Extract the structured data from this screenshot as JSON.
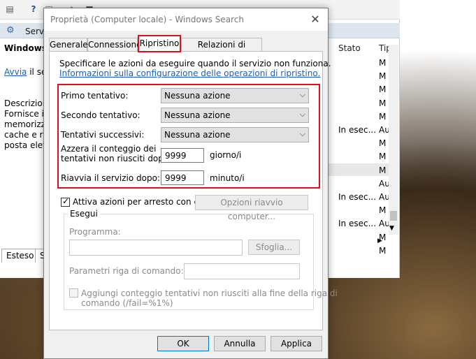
{
  "background": {
    "panel_label": "Servizi",
    "service_title": "Windows S",
    "start_link": "Avvia",
    "start_suffix": " il ser",
    "description_heading": "Descrizione",
    "description_lines": [
      "Fornisce in",
      "memorizza",
      "cache e ris",
      "posta elett"
    ],
    "columns": {
      "status": "Stato",
      "type": "Tip"
    },
    "rows": [
      {
        "status": "",
        "type": "M"
      },
      {
        "status": "",
        "type": "M"
      },
      {
        "status": "",
        "type": "M"
      },
      {
        "status": "",
        "type": "M"
      },
      {
        "status": "",
        "type": "M"
      },
      {
        "status": "In esec...",
        "type": "Au"
      },
      {
        "status": "",
        "type": "M"
      },
      {
        "status": "",
        "type": "M"
      },
      {
        "status": "",
        "type": "M"
      },
      {
        "status": "",
        "type": "Au"
      },
      {
        "status": "In esec...",
        "type": "Au"
      },
      {
        "status": "",
        "type": "M"
      },
      {
        "status": "In esec...",
        "type": "Au"
      },
      {
        "status": "",
        "type": "M"
      },
      {
        "status": "",
        "type": "M"
      }
    ],
    "tabs": [
      "Esteso",
      "S"
    ]
  },
  "dialog": {
    "title": "Proprietà (Computer locale) - Windows Search",
    "tabs": [
      "Generale",
      "Connessione",
      "Ripristino",
      "Relazioni di dipendenza"
    ],
    "active_tab": "Ripristino",
    "intro": "Specificare le azioni da eseguire quando il servizio non funziona.",
    "info_link": "Informazioni sulla configurazione delle operazioni di ripristino.",
    "first_failure_label": "Primo tentativo:",
    "first_failure_value": "Nessuna azione",
    "second_failure_label": "Secondo tentativo:",
    "second_failure_value": "Nessuna azione",
    "subsequent_label": "Tentativi successivi:",
    "subsequent_value": "Nessuna azione",
    "reset_label_line1": "Azzera il conteggio dei",
    "reset_label_line2": "tentativi non riusciti dopo:",
    "reset_value": "9999",
    "reset_unit": "giorno/i",
    "restart_label": "Riavvia il servizio dopo:",
    "restart_value": "9999",
    "restart_unit": "minuto/i",
    "enable_actions_label": "Attiva azioni per arresto con errori.",
    "enable_actions_checked": true,
    "restart_options_button": "Opzioni riavvio computer...",
    "run_group_label": "Esegui",
    "program_label": "Programma:",
    "browse_button": "Sfoglia...",
    "params_label": "Parametri riga di comando:",
    "append_fail_line1": "Aggiungi conteggio tentativi non riusciti alla fine della riga di",
    "append_fail_line2": "comando (/fail=%1%)",
    "ok_button": "OK",
    "cancel_button": "Annulla",
    "apply_button": "Applica"
  }
}
